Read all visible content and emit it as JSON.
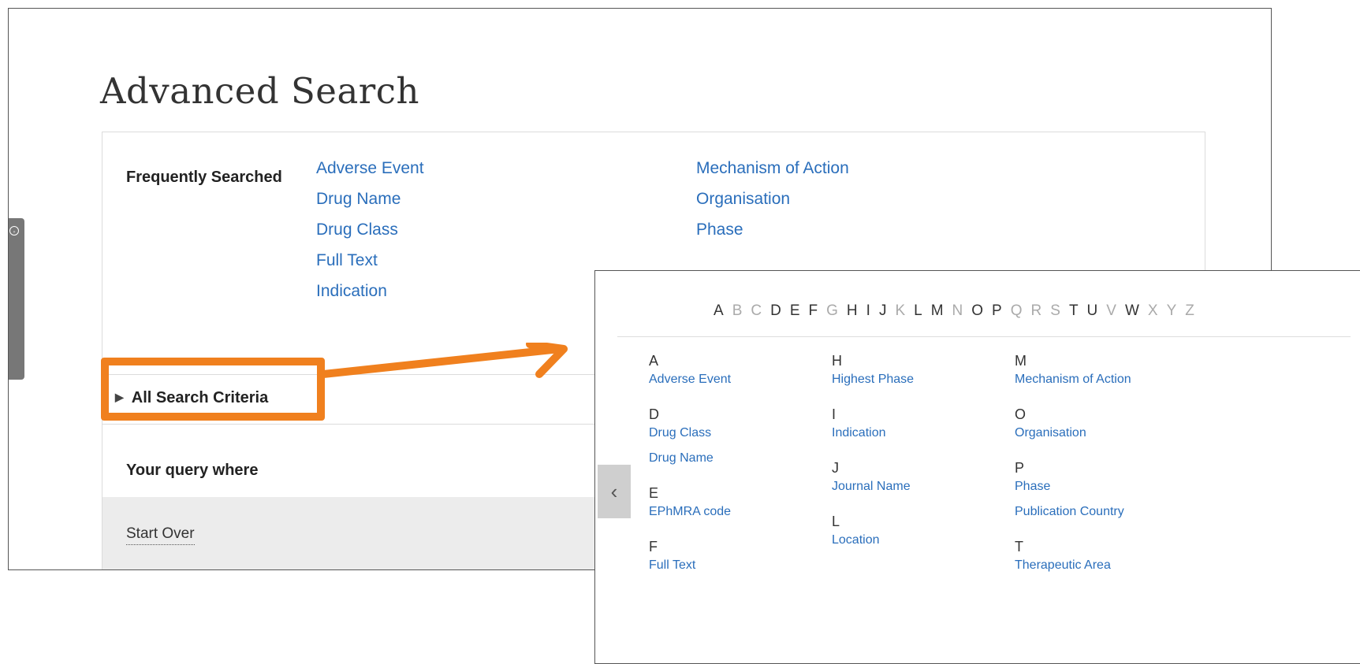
{
  "page": {
    "title": "Advanced Search",
    "side_tab_icon": "settings-circle-icon"
  },
  "frequently_searched": {
    "label": "Frequently Searched",
    "links_col1": [
      "Adverse Event",
      "Drug Name",
      "Drug Class",
      "Full Text",
      "Indication"
    ],
    "links_col2": [
      "Mechanism of Action",
      "Organisation",
      "Phase"
    ]
  },
  "criteria": {
    "label": "All Search Criteria",
    "arrow_icon": "triangle-right-icon"
  },
  "query": {
    "label": "Your query where"
  },
  "footer": {
    "start_over": "Start Over"
  },
  "colors": {
    "highlight": "#f0801e",
    "link": "#2a6ebb"
  },
  "popup": {
    "alphabet": [
      {
        "letter": "A",
        "active": true
      },
      {
        "letter": "B",
        "active": false
      },
      {
        "letter": "C",
        "active": false
      },
      {
        "letter": "D",
        "active": true
      },
      {
        "letter": "E",
        "active": true
      },
      {
        "letter": "F",
        "active": true
      },
      {
        "letter": "G",
        "active": false
      },
      {
        "letter": "H",
        "active": true
      },
      {
        "letter": "I",
        "active": true
      },
      {
        "letter": "J",
        "active": true
      },
      {
        "letter": "K",
        "active": false
      },
      {
        "letter": "L",
        "active": true
      },
      {
        "letter": "M",
        "active": true
      },
      {
        "letter": "N",
        "active": false
      },
      {
        "letter": "O",
        "active": true
      },
      {
        "letter": "P",
        "active": true
      },
      {
        "letter": "Q",
        "active": false
      },
      {
        "letter": "R",
        "active": false
      },
      {
        "letter": "S",
        "active": false
      },
      {
        "letter": "T",
        "active": true
      },
      {
        "letter": "U",
        "active": true
      },
      {
        "letter": "V",
        "active": false
      },
      {
        "letter": "W",
        "active": true
      },
      {
        "letter": "X",
        "active": false
      },
      {
        "letter": "Y",
        "active": false
      },
      {
        "letter": "Z",
        "active": false
      }
    ],
    "collapse_icon": "chevron-left-icon",
    "col1": {
      "a": "A",
      "a_links": [
        "Adverse Event"
      ],
      "d": "D",
      "d_links": [
        "Drug Class",
        "Drug Name"
      ],
      "e": "E",
      "e_links": [
        "EPhMRA code"
      ],
      "f": "F",
      "f_links": [
        "Full Text"
      ]
    },
    "col2": {
      "h": "H",
      "h_links": [
        "Highest Phase"
      ],
      "i": "I",
      "i_links": [
        "Indication"
      ],
      "j": "J",
      "j_links": [
        "Journal Name"
      ],
      "l": "L",
      "l_links": [
        "Location"
      ]
    },
    "col3": {
      "m": "M",
      "m_links": [
        "Mechanism of Action"
      ],
      "o": "O",
      "o_links": [
        "Organisation"
      ],
      "p": "P",
      "p_links": [
        "Phase",
        "Publication Country"
      ],
      "t": "T",
      "t_links": [
        "Therapeutic Area"
      ]
    }
  }
}
